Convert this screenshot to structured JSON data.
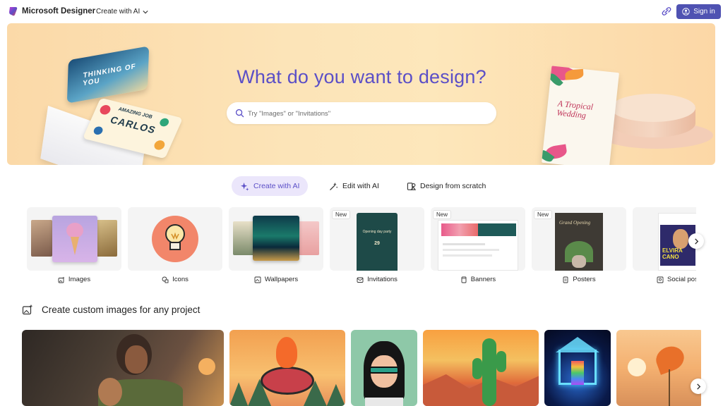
{
  "header": {
    "app_title": "Microsoft Designer",
    "create_menu_label": "Create with AI",
    "signin_label": "Sign in",
    "accent_color": "#4f52b2"
  },
  "hero": {
    "title": "What do you want to design?",
    "search_placeholder": "Try \"Images\" or \"Invitations\"",
    "decor_text": {
      "thinking_card": "THINKING OF YOU",
      "carlos_card_small": "AMAZING JOB",
      "carlos_card": "CARLOS",
      "wedding_card": "A Tropical Wedding"
    }
  },
  "mode_tabs": [
    {
      "label": "Create with AI",
      "icon": "sparkle-icon",
      "active": true
    },
    {
      "label": "Edit with AI",
      "icon": "magic-wand-icon",
      "active": false
    },
    {
      "label": "Design from scratch",
      "icon": "design-shapes-icon",
      "active": false
    }
  ],
  "categories": [
    {
      "label": "Images",
      "icon": "image-sparkle-icon",
      "new": false
    },
    {
      "label": "Icons",
      "icon": "shapes-icon",
      "new": false
    },
    {
      "label": "Wallpapers",
      "icon": "wallpaper-icon",
      "new": false
    },
    {
      "label": "Invitations",
      "icon": "invitation-icon",
      "new": true,
      "badge": "New"
    },
    {
      "label": "Banners",
      "icon": "banner-icon",
      "new": true,
      "badge": "New"
    },
    {
      "label": "Posters",
      "icon": "poster-icon",
      "new": true,
      "badge": "New"
    },
    {
      "label": "Social pos",
      "icon": "social-post-icon",
      "new": false
    }
  ],
  "category_thumb_text": {
    "invitation": "Opening day party",
    "invitation_date": "29",
    "poster": "Grand Opening",
    "social": "ELVIRA CANO"
  },
  "section": {
    "title": "Create custom images for any project"
  }
}
